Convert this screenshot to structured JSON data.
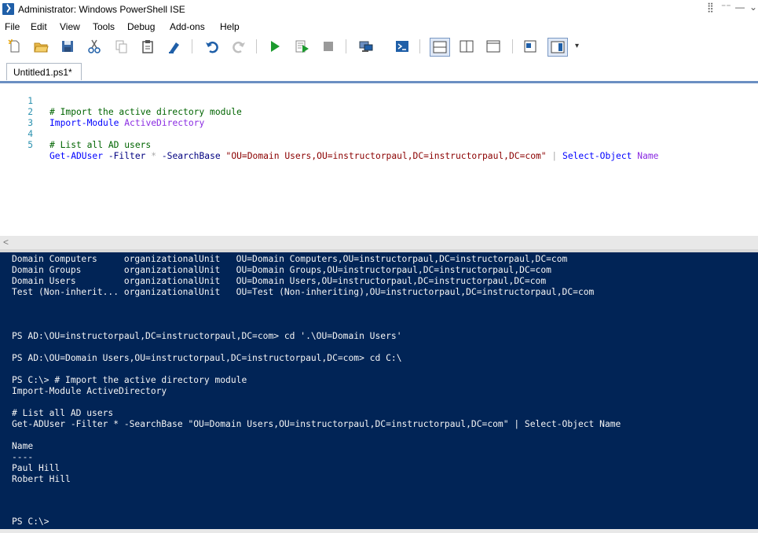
{
  "window": {
    "title": "Administrator: Windows PowerShell ISE",
    "controls": [
      "⣿",
      "⁻⁻",
      "—",
      "⌄"
    ]
  },
  "menu": [
    "File",
    "Edit",
    "View",
    "Tools",
    "Debug",
    "Add-ons",
    "Help"
  ],
  "toolbar": {
    "overflow": "▾"
  },
  "tabs": [
    {
      "label": "Untitled1.ps1*"
    }
  ],
  "editor": {
    "line_numbers": [
      "1",
      "2",
      "3",
      "4",
      "5"
    ],
    "line1": "# Import the active directory module",
    "line2_cmd": "Import-Module",
    "line2_arg": "ActiveDirectory",
    "line4": "# List all AD users",
    "line5": {
      "cmd": "Get-ADUser",
      "p1": "-Filter",
      "star": "*",
      "p2": "-SearchBase",
      "str": "\"OU=Domain Users,OU=instructorpaul,DC=instructorpaul,DC=com\"",
      "pipe": "|",
      "cmd2": "Select-Object",
      "arg": "Name"
    }
  },
  "scrollbar": {
    "left_arrow": "<"
  },
  "console": {
    "lines": [
      "Domain Computers     organizationalUnit   OU=Domain Computers,OU=instructorpaul,DC=instructorpaul,DC=com",
      "Domain Groups        organizationalUnit   OU=Domain Groups,OU=instructorpaul,DC=instructorpaul,DC=com",
      "Domain Users         organizationalUnit   OU=Domain Users,OU=instructorpaul,DC=instructorpaul,DC=com",
      "Test (Non-inherit... organizationalUnit   OU=Test (Non-inheriting),OU=instructorpaul,DC=instructorpaul,DC=com",
      "",
      "",
      "",
      "PS AD:\\OU=instructorpaul,DC=instructorpaul,DC=com> cd '.\\OU=Domain Users'",
      "",
      "PS AD:\\OU=Domain Users,OU=instructorpaul,DC=instructorpaul,DC=com> cd C:\\",
      "",
      "PS C:\\> # Import the active directory module",
      "Import-Module ActiveDirectory",
      "",
      "# List all AD users",
      "Get-ADUser -Filter * -SearchBase \"OU=Domain Users,OU=instructorpaul,DC=instructorpaul,DC=com\" | Select-Object Name",
      "",
      "Name",
      "----",
      "Paul Hill",
      "Robert Hill",
      "",
      "",
      "",
      "",
      "PS C:\\>"
    ]
  },
  "colors": {
    "console_bg": "#012456",
    "comment": "#006400",
    "command": "#0000ff",
    "parameter": "#000080",
    "argument": "#8a2be2",
    "string": "#8b0000"
  },
  "icons": [
    "new-file-icon",
    "open-file-icon",
    "save-icon",
    "cut-icon",
    "copy-icon",
    "paste-icon",
    "clear-console-icon",
    "undo-icon",
    "redo-icon",
    "run-script-icon",
    "run-selection-icon",
    "stop-icon",
    "remote-powershell-icon",
    "start-powershell-icon",
    "show-script-pane-top-icon",
    "show-script-pane-right-icon",
    "show-script-pane-maximized-icon",
    "show-command-window-icon",
    "show-command-addon-icon"
  ]
}
